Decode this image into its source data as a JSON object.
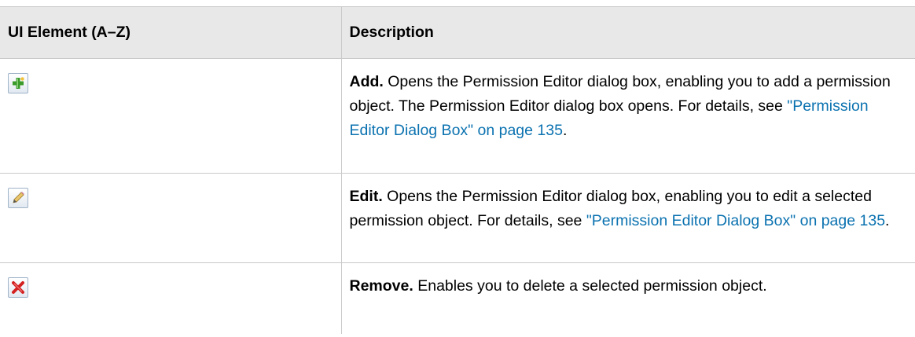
{
  "table": {
    "headers": [
      "UI Element (A–Z)",
      "Description"
    ],
    "rows": [
      {
        "icon": "add-icon",
        "term": "Add.",
        "text": " Opens the Permission Editor dialog box, enabling you to add a permission object. The Permission Editor dialog box opens. For details, see ",
        "link": "\"Permission Editor Dialog Box\" on page 135",
        "tail": "."
      },
      {
        "icon": "edit-icon",
        "term": "Edit.",
        "text": " Opens the Permission Editor dialog box, enabling you to edit a selected permission object. For details, see ",
        "link": "\"Permission Editor Dialog Box\" on page 135",
        "tail": "."
      },
      {
        "icon": "remove-icon",
        "term": "Remove.",
        "text": " Enables you to delete a selected permission object."
      }
    ]
  },
  "colors": {
    "header_bg": "#e8e8e8",
    "border": "#c9c9c9",
    "link": "#0b72b0",
    "add_icon": "#3a9a2a",
    "remove_icon": "#d42020"
  }
}
